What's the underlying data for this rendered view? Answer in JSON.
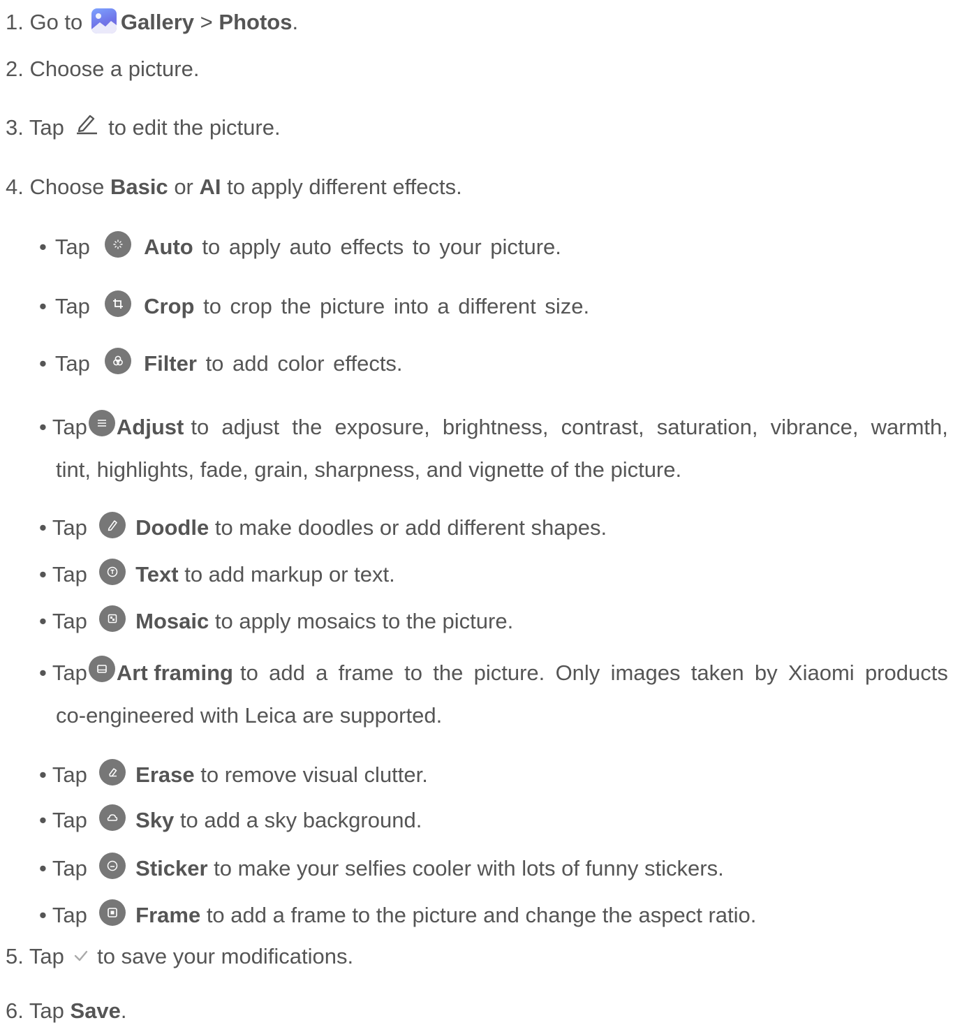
{
  "steps": {
    "s1": {
      "prefix": "1. Go to",
      "gallery": "Gallery",
      "sep": ">",
      "photos": "Photos",
      "end": "."
    },
    "s2": {
      "text": "2. Choose a picture."
    },
    "s3": {
      "prefix": "3. Tap",
      "rest": "to edit the picture."
    },
    "s4": {
      "prefix": "4. Choose",
      "basic": "Basic",
      "or": "or",
      "ai": "AI",
      "rest": "to apply different effects."
    },
    "s5": {
      "prefix": "5. Tap",
      "rest": "to save your modifications."
    },
    "s6": {
      "prefix": "6. Tap",
      "save": "Save",
      "end": "."
    }
  },
  "tools": [
    {
      "icon": "auto-magic-icon",
      "tap": "• Tap",
      "name": "Auto",
      "desc": "to apply auto effects to your picture."
    },
    {
      "icon": "crop-icon",
      "tap": "• Tap",
      "name": "Crop",
      "desc": "to crop the picture into a different size."
    },
    {
      "icon": "filter-icon",
      "tap": "• Tap",
      "name": "Filter",
      "desc": "to add color effects."
    },
    {
      "icon": "adjust-icon",
      "tap": "• Tap",
      "name": "Adjust",
      "desc1": "to adjust the exposure, brightness, contrast, saturation, vibrance, warmth,",
      "desc2": "tint, highlights, fade, grain, sharpness, and vignette of the picture."
    },
    {
      "icon": "doodle-icon",
      "tap": "• Tap",
      "name": "Doodle",
      "desc": "to make doodles or add different shapes."
    },
    {
      "icon": "text-icon",
      "tap": "• Tap",
      "name": "Text",
      "desc": "to add markup or text."
    },
    {
      "icon": "mosaic-icon",
      "tap": "• Tap",
      "name": "Mosaic",
      "desc": "to apply mosaics to the picture."
    },
    {
      "icon": "art-framing-icon",
      "tap": "• Tap",
      "name": "Art framing",
      "desc1": "to add a frame to the picture. Only images taken by Xiaomi products",
      "desc2": "co-engineered with Leica are supported."
    },
    {
      "icon": "erase-icon",
      "tap": "• Tap",
      "name": "Erase",
      "desc": "to remove visual clutter."
    },
    {
      "icon": "sky-icon",
      "tap": "• Tap",
      "name": "Sky",
      "desc": "to add a sky background."
    },
    {
      "icon": "sticker-icon",
      "tap": "• Tap",
      "name": "Sticker",
      "desc": "to make your selfies cooler with lots of funny stickers."
    },
    {
      "icon": "frame-icon",
      "tap": "• Tap",
      "name": "Frame",
      "desc": "to add a frame to the picture and change the aspect ratio."
    }
  ],
  "colors": {
    "text": "#555555",
    "icon_bg": "#777777",
    "gallery_icon": "#6f74e8"
  }
}
